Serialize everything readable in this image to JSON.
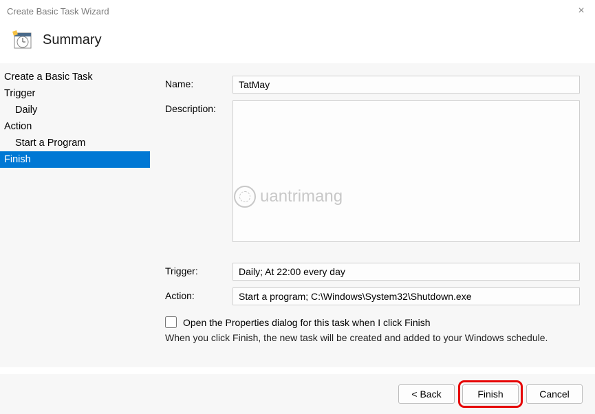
{
  "window": {
    "title": "Create Basic Task Wizard",
    "close_icon": "×"
  },
  "header": {
    "title": "Summary",
    "icon": "schedule-icon"
  },
  "sidebar": {
    "items": [
      {
        "label": "Create a Basic Task",
        "indent": false,
        "selected": false
      },
      {
        "label": "Trigger",
        "indent": false,
        "selected": false
      },
      {
        "label": "Daily",
        "indent": true,
        "selected": false
      },
      {
        "label": "Action",
        "indent": false,
        "selected": false
      },
      {
        "label": "Start a Program",
        "indent": true,
        "selected": false
      },
      {
        "label": "Finish",
        "indent": false,
        "selected": true
      }
    ]
  },
  "form": {
    "name_label": "Name:",
    "name_value": "TatMay",
    "description_label": "Description:",
    "description_value": "",
    "trigger_label": "Trigger:",
    "trigger_value": "Daily; At 22:00 every day",
    "action_label": "Action:",
    "action_value": "Start a program; C:\\Windows\\System32\\Shutdown.exe",
    "checkbox_label": "Open the Properties dialog for this task when I click Finish",
    "checkbox_checked": false,
    "hint": "When you click Finish, the new task will be created and added to your Windows schedule."
  },
  "buttons": {
    "back": "< Back",
    "finish": "Finish",
    "cancel": "Cancel"
  },
  "watermark": {
    "text": "uantrimang"
  }
}
